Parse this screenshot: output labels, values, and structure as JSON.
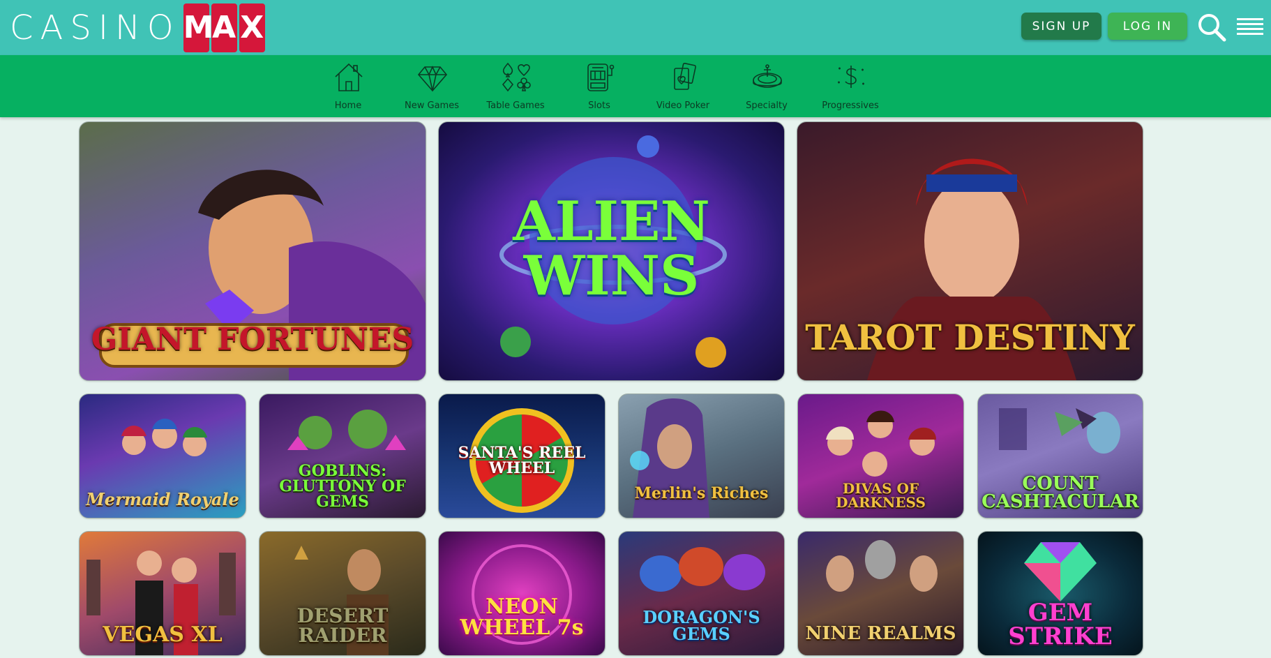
{
  "brand": {
    "part1": "CASINO",
    "part2": [
      "M",
      "A",
      "X"
    ]
  },
  "header": {
    "signup_label": "SIGN UP",
    "login_label": "LOG IN",
    "search_icon": "search-icon",
    "menu_icon": "hamburger-menu-icon"
  },
  "nav": [
    {
      "label": "Home",
      "icon": "home-icon"
    },
    {
      "label": "New Games",
      "icon": "diamond-icon"
    },
    {
      "label": "Table Games",
      "icon": "card-suits-icon"
    },
    {
      "label": "Slots",
      "icon": "slot-machine-icon"
    },
    {
      "label": "Video Poker",
      "icon": "playing-cards-icon"
    },
    {
      "label": "Specialty",
      "icon": "roulette-wheel-icon"
    },
    {
      "label": "Progressives",
      "icon": "dollar-icon"
    }
  ],
  "featured": [
    {
      "title": "GIANT FORTUNES"
    },
    {
      "title": "ALIEN WINS"
    },
    {
      "title": "TAROT DESTINY"
    }
  ],
  "row1": [
    {
      "title": "Mermaid Royale"
    },
    {
      "title": "GOBLINS: GLUTTONY OF GEMS"
    },
    {
      "title": "SANTA'S REEL WHEEL"
    },
    {
      "title": "Merlin's Riches"
    },
    {
      "title": "DIVAS OF DARKNESS"
    },
    {
      "title": "COUNT CASHTACULAR"
    }
  ],
  "row2": [
    {
      "title": "VEGAS XL"
    },
    {
      "title": "DESERT RAIDER"
    },
    {
      "title": "NEON WHEEL 7s"
    },
    {
      "title": "DORAGON'S GEMS"
    },
    {
      "title": "NINE REALMS"
    },
    {
      "title": "GEM STRIKE"
    }
  ],
  "colors": {
    "header_bg": "#40c3b6",
    "nav_bg": "#06b061",
    "signup_bg": "#227a4a",
    "login_bg": "#3eb455",
    "max_red": "#d5173a",
    "page_bg": "#e6f3ee"
  }
}
